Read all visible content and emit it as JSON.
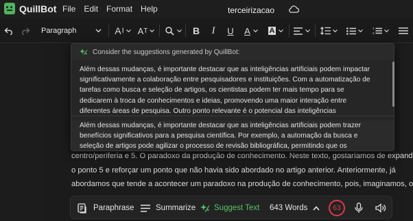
{
  "app": {
    "name": "QuillBot",
    "document_title": "terceirizacao"
  },
  "menu": [
    "File",
    "Edit",
    "Format",
    "Help"
  ],
  "toolbar": {
    "paragraph_style": "Paragraph"
  },
  "popup": {
    "header": "Consider the suggestions generated by QuillBot:",
    "suggestion1": [
      "Além dessas mudanças, é importante destacar que as inteligências artificiais podem impactar",
      "significativamente a colaboração entre pesquisadores e instituições. Com a automatização de",
      "tarefas como busca e seleção de artigos, os cientistas podem ter mais tempo para se",
      "dedicarem à troca de conhecimentos e ideias, promovendo uma maior interação entre",
      "diferentes áreas de pesquisa. Outro ponto relevante é o potencial das inteligências"
    ],
    "suggestion2": [
      "Além dessas mudanças, é importante destacar que as inteligências artificiais podem trazer",
      "benefícios significativos para a pesquisa científica. Por exemplo, a automação da busca e",
      "seleção de artigos pode agilizar o processo de revisão bibliográfica, permitindo que os"
    ]
  },
  "document": {
    "lines": [
      "centro/periferia e 5. O paradoxo da produção de conhecimento. Neste texto, gostaríamos de expandir",
      "o ponto 5 e reforçar um ponto que não havia sido abordado no artigo anterior. Anteriormente, já",
      "abordamos que tende a acontecer um paradoxo na produção de conhecimento, pois, imaginamos, os"
    ]
  },
  "bottombar": {
    "paraphrase": "Paraphrase",
    "summarize": "Summarize",
    "suggest_text": "Suggest Text",
    "word_count": "643 Words",
    "issues_count": "63"
  },
  "colors": {
    "accent_green": "#56c26a",
    "alert_red": "#e0394b"
  }
}
